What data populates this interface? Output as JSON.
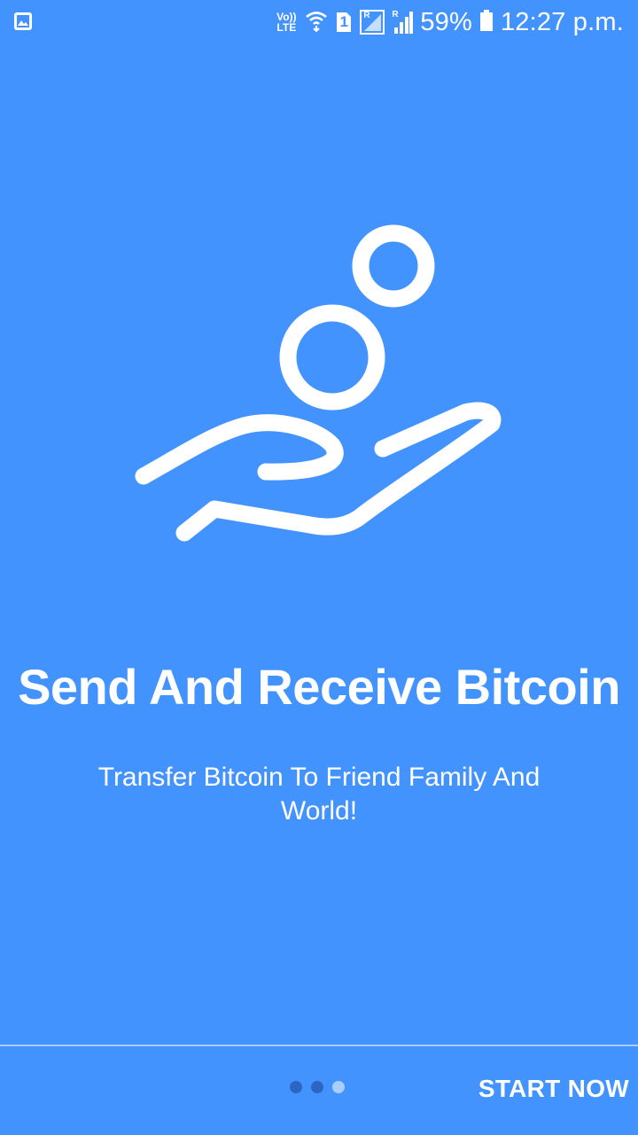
{
  "status_bar": {
    "volte_top": "Vo))",
    "volte_bottom": "LTE",
    "sim_number": "1",
    "roaming_label": "R",
    "battery": "59%",
    "time": "12:27 p.m.",
    "icons": [
      "gallery-icon",
      "wifi-icon",
      "sim-icon",
      "signal-icon",
      "battery-icon"
    ]
  },
  "onboarding": {
    "title": "Send And Receive Bitcoin",
    "subtitle": "Transfer Bitcoin To Friend Family And World!",
    "illustration": "hand-with-coins-icon",
    "page_indicator": {
      "total": 3,
      "active": 3
    },
    "start_label": "START NOW"
  },
  "colors": {
    "background": "#4393FF",
    "text": "#FFFFFF",
    "dot_inactive": "#2B67C2",
    "dot_active": "#A9CDFF"
  }
}
